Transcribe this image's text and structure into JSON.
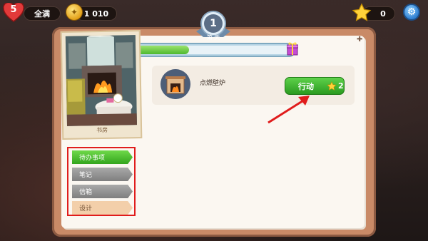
{
  "hud": {
    "lives": "5",
    "lives_status": "全满",
    "coins": "1 010",
    "stars": "0"
  },
  "day": {
    "number": "1",
    "label": "第 天",
    "progress": 0.35
  },
  "room": {
    "name": "书房"
  },
  "tabs": [
    {
      "label": "待办事项"
    },
    {
      "label": "笔记"
    },
    {
      "label": "信箱"
    },
    {
      "label": "设计"
    }
  ],
  "task": {
    "name": "点燃壁炉",
    "action_label": "行动",
    "star_cost": "2"
  },
  "colors": {
    "accent_green": "#3fb12b",
    "highlight_red": "#e01c1c"
  }
}
